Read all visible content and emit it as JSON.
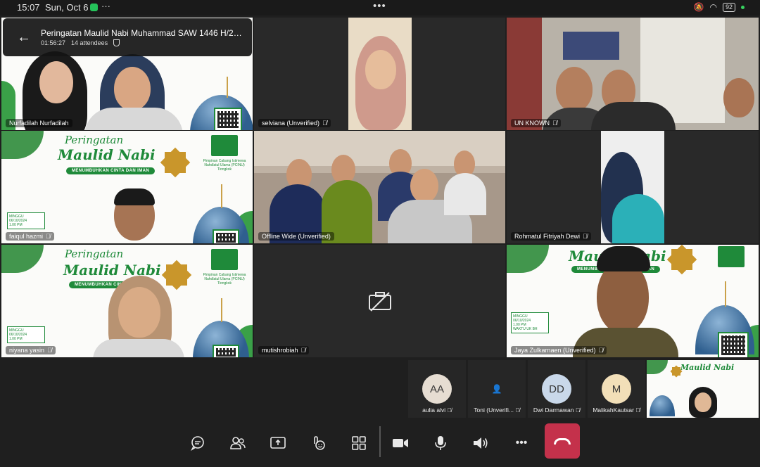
{
  "status_bar": {
    "time": "15:07",
    "date": "Sun, Oct 6",
    "overflow": "···",
    "center_handle": "•••",
    "battery": "92"
  },
  "meeting": {
    "title": "Peringatan Maulid Nabi Muhammad SAW 1446 H/2024 ...",
    "duration": "01:56:27",
    "attendees": "14 attendees"
  },
  "banner": {
    "line1": "Peringatan",
    "line2": "Maulid Nabi",
    "tagline": "MENUMBUHKAN CINTA DAN IMAN",
    "org": "Pimpinan Cabang Istimewa Nahdlatul Ulama (PCINU) Tiongkok",
    "day": "MINGGU",
    "date": "06/10/2024",
    "time": "1.00 PM",
    "tz": "WAKTU UK BH",
    "arabic": "محمد"
  },
  "participants": [
    {
      "name": "Nurfadilah Nurfadilah",
      "muted": false
    },
    {
      "name": "selviana (Unverified)",
      "muted": true
    },
    {
      "name": "UN KNOWN",
      "muted": true
    },
    {
      "name": "faiqul hazmi",
      "muted": true
    },
    {
      "name": "Offline Wide (Unverified)",
      "muted": false
    },
    {
      "name": "Rohmatul Fitriyah Dewi",
      "muted": true
    },
    {
      "name": "niyana yasin",
      "muted": true
    },
    {
      "name": "mutishrobiah",
      "muted": true
    },
    {
      "name": "Jaya Zulkarnaen (Unverified)",
      "muted": true
    }
  ],
  "mini_tiles": [
    {
      "initials": "AA",
      "name": "aulia alvi",
      "color": "#e6ddd2"
    },
    {
      "initials": "",
      "name": "Toni (Unverifi...",
      "color": "#262626"
    },
    {
      "initials": "DD",
      "name": "Dwi Darmawan",
      "color": "#c9d8ea"
    },
    {
      "initials": "M",
      "name": "MalikahKautsar",
      "color": "#f2dfb8"
    }
  ],
  "colors": {
    "hangup": "#c4314b",
    "banner_green": "#1f8a3a",
    "tile_bg": "#292929"
  },
  "toolbar": {
    "chat": "chat-icon",
    "people": "people-icon",
    "share": "share-screen-icon",
    "react": "react-icon",
    "view": "grid-view-icon",
    "camera": "camera-icon",
    "mic": "mic-icon",
    "speaker": "speaker-icon",
    "more": "•••",
    "hangup": "hang-up-icon"
  }
}
